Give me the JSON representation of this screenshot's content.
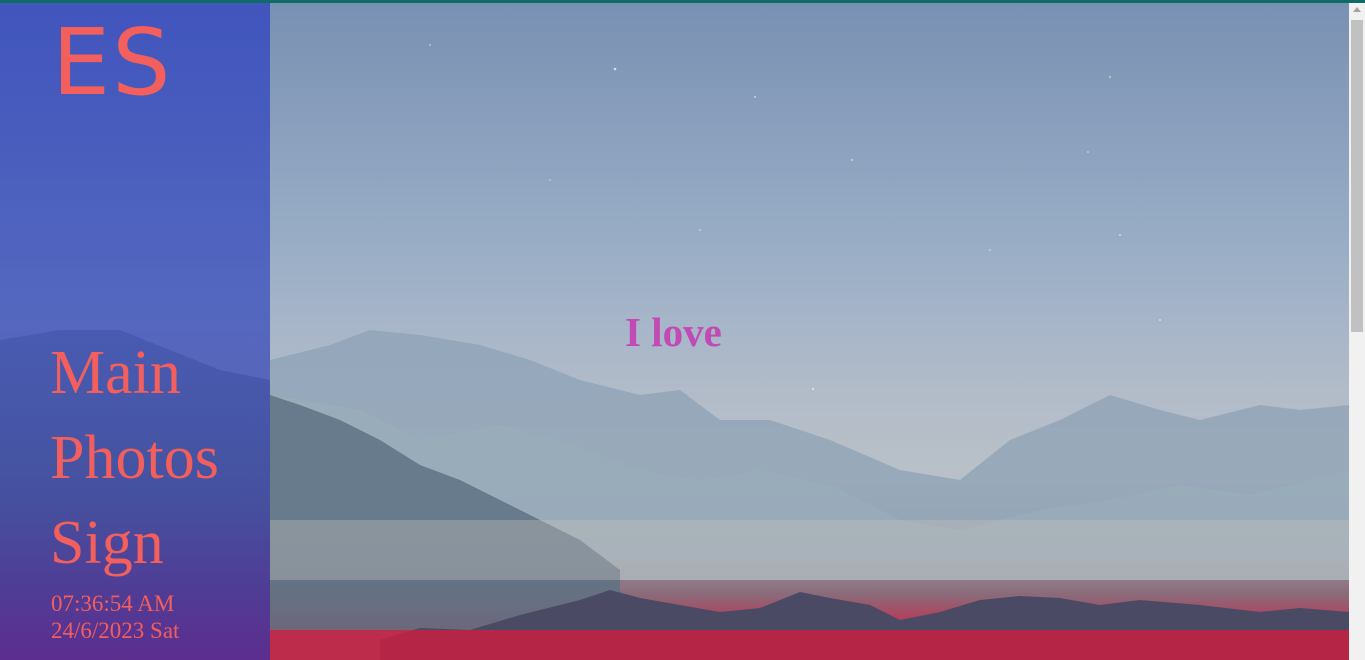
{
  "logo": {
    "text": "ES"
  },
  "nav": {
    "items": [
      {
        "label": "Main"
      },
      {
        "label": "Photos"
      },
      {
        "label": "Sign"
      }
    ]
  },
  "clock": {
    "time": "07:36:54 AM",
    "date": "24/6/2023 Sat"
  },
  "main": {
    "headline": "I love"
  },
  "colors": {
    "accent": "#f25f5c",
    "headline": "#c04bb5",
    "sidebar": "#3c50be",
    "horizon": "#d81a3c"
  }
}
